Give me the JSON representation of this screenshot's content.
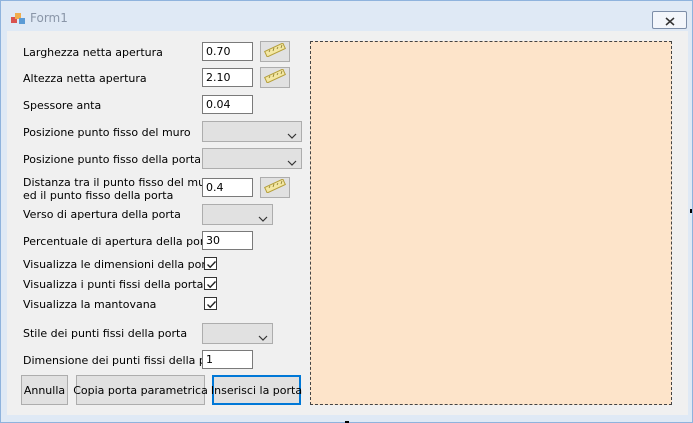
{
  "window": {
    "title": "Form1"
  },
  "fields": {
    "larghezza": {
      "label": "Larghezza netta apertura",
      "value": "0.70"
    },
    "altezza": {
      "label": "Altezza netta apertura",
      "value": "2.10"
    },
    "spessore": {
      "label": "Spessore anta",
      "value": "0.04"
    },
    "pos_muro": {
      "label": "Posizione punto fisso del muro",
      "value": ""
    },
    "pos_porta": {
      "label": "Posizione punto fisso della porta",
      "value": ""
    },
    "distanza": {
      "label_line1": "Distanza tra il punto fisso del muro",
      "label_line2": "ed il punto fisso della porta",
      "value": "0.4"
    },
    "verso": {
      "label": "Verso di apertura della porta",
      "value": ""
    },
    "percentuale": {
      "label": "Percentuale di apertura della porta",
      "value": "30"
    },
    "vis_dimensioni": {
      "label": "Visualizza le dimensioni della porta",
      "checked": true
    },
    "vis_punti": {
      "label": "Visualizza i punti fissi della porta",
      "checked": true
    },
    "vis_mantovana": {
      "label": "Visualizza la mantovana",
      "checked": true
    },
    "stile": {
      "label": "Stile dei punti fissi della porta",
      "value": ""
    },
    "dimensione": {
      "label": "Dimensione dei punti fissi della porta",
      "value": "1"
    }
  },
  "buttons": {
    "annulla": "Annulla",
    "copia": "Copia porta parametrica",
    "inserisci": "Inserisci la porta"
  },
  "colors": {
    "preview_bg": "#fde4ca",
    "window_frame": "#dfe9f5",
    "client_bg": "#f0f0f0",
    "default_button_border": "#0078d7"
  },
  "icons": {
    "app": "form-app-icon",
    "close": "close-icon",
    "ruler": "ruler-icon",
    "dropdown": "chevron-down-icon",
    "check": "check-icon"
  }
}
